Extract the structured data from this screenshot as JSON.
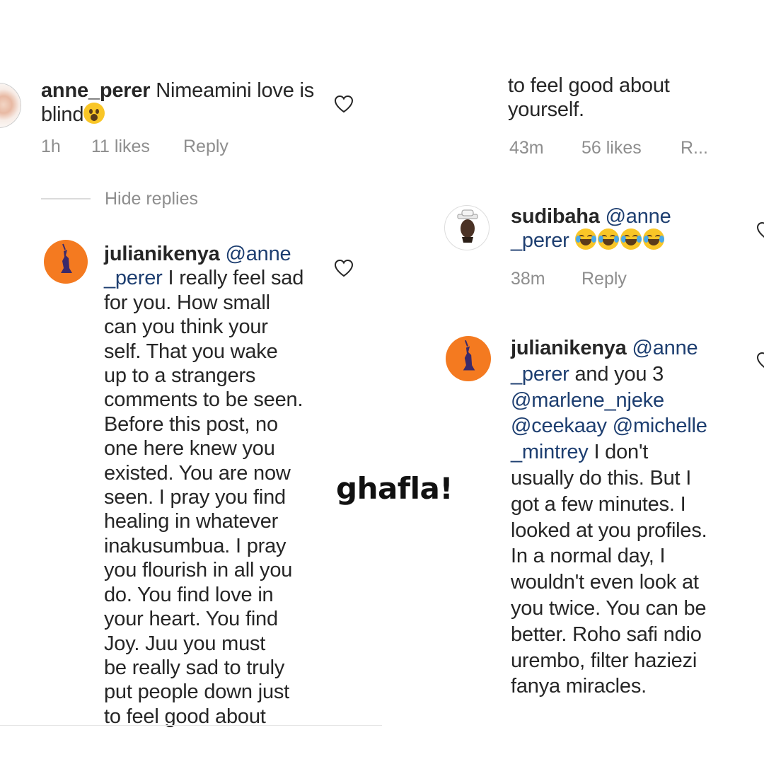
{
  "left": {
    "comment1": {
      "username": "anne_perer",
      "text_line1": "Nimeamini love is",
      "text_line2": "blind",
      "emoji": "astonished-face-emoji",
      "time": "1h",
      "likes": "11 likes",
      "reply": "Reply"
    },
    "hide_replies": "Hide replies",
    "reply1": {
      "username": "julianikenya",
      "mention_part1": "@anne",
      "mention_part2": "_perer",
      "lines": [
        " I really feel sad",
        "for you. How small",
        "can you think your",
        "self.  That you wake",
        "up to a strangers",
        "comments to be seen.",
        "Before this post, no",
        "one here knew you",
        "existed. You are now",
        "seen. I pray you find",
        "healing in whatever",
        "inakusumbua. I pray",
        "you flourish in all you",
        "do. You find love in",
        "your heart. You find",
        "Joy. Juu you must",
        "be really sad to truly",
        "put people down just",
        "to feel good about"
      ]
    }
  },
  "right": {
    "continued": {
      "lines": [
        "to feel good about",
        "yourself."
      ],
      "time": "43m",
      "likes": "56 likes",
      "reply": "R..."
    },
    "reply2": {
      "username": "sudibaha",
      "mention_part1": "@anne",
      "mention_part2": "_perer",
      "emoji": "laughing-tears-emoji",
      "time": "38m",
      "reply": "Reply"
    },
    "reply3": {
      "username": "julianikenya",
      "mention_part1": "@anne",
      "mention_part2": "_perer",
      "after_mention": " and you 3",
      "mention3": "@marlene_njeke",
      "mention4": "@ceekaay",
      "mention5": "@michelle",
      "mention5b": "_mintrey",
      "after_mention5": " I don't",
      "lines": [
        "usually do this. But I",
        "got a few minutes. I",
        "looked at you profiles.",
        "In a normal day, I",
        "wouldn't even look at",
        "you twice. You can be",
        "better. Roho safi ndio",
        "urembo, filter haziezi",
        "fanya miracles."
      ]
    }
  },
  "watermark": "ghafla!",
  "colors": {
    "text": "#262626",
    "meta": "#8e8e8e",
    "mention": "#1d3e70",
    "avatar_orange": "#f47a20"
  }
}
